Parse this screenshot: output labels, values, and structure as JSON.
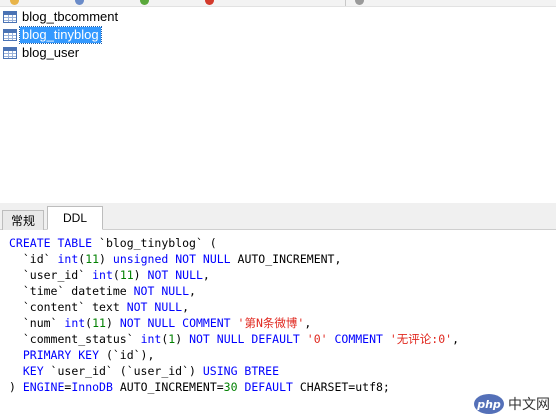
{
  "objects": [
    {
      "name": "blog_tbcomment",
      "selected": false
    },
    {
      "name": "blog_tinyblog",
      "selected": true
    },
    {
      "name": "blog_user",
      "selected": false
    }
  ],
  "tabs": [
    {
      "label": "常规",
      "active": false
    },
    {
      "label": "DDL",
      "active": true
    }
  ],
  "ddl": {
    "lines": [
      [
        [
          "kw",
          "CREATE TABLE "
        ],
        [
          "tx",
          "`blog_tinyblog` ("
        ]
      ],
      [
        [
          "tx",
          "  `id` "
        ],
        [
          "kw",
          "int"
        ],
        [
          "tx",
          "("
        ],
        [
          "num",
          "11"
        ],
        [
          "tx",
          ") "
        ],
        [
          "kw",
          "unsigned NOT NULL "
        ],
        [
          "tx",
          "AUTO_INCREMENT,"
        ]
      ],
      [
        [
          "tx",
          "  `user_id` "
        ],
        [
          "kw",
          "int"
        ],
        [
          "tx",
          "("
        ],
        [
          "num",
          "11"
        ],
        [
          "tx",
          ") "
        ],
        [
          "kw",
          "NOT NULL"
        ],
        [
          "tx",
          ","
        ]
      ],
      [
        [
          "tx",
          "  `time` datetime "
        ],
        [
          "kw",
          "NOT NULL"
        ],
        [
          "tx",
          ","
        ]
      ],
      [
        [
          "tx",
          "  `content` text "
        ],
        [
          "kw",
          "NOT NULL"
        ],
        [
          "tx",
          ","
        ]
      ],
      [
        [
          "tx",
          "  `num` "
        ],
        [
          "kw",
          "int"
        ],
        [
          "tx",
          "("
        ],
        [
          "num",
          "11"
        ],
        [
          "tx",
          ") "
        ],
        [
          "kw",
          "NOT NULL COMMENT "
        ],
        [
          "str",
          "'第N条微博'"
        ],
        [
          "tx",
          ","
        ]
      ],
      [
        [
          "tx",
          "  `comment_status` "
        ],
        [
          "kw",
          "int"
        ],
        [
          "tx",
          "("
        ],
        [
          "num",
          "1"
        ],
        [
          "tx",
          ") "
        ],
        [
          "kw",
          "NOT NULL DEFAULT "
        ],
        [
          "str",
          "'0'"
        ],
        [
          "kw",
          " COMMENT "
        ],
        [
          "str",
          "'无评论:0'"
        ],
        [
          "tx",
          ","
        ]
      ],
      [
        [
          "kw",
          "  PRIMARY KEY "
        ],
        [
          "tx",
          "(`id`),"
        ]
      ],
      [
        [
          "kw",
          "  KEY "
        ],
        [
          "tx",
          "`user_id` (`user_id`) "
        ],
        [
          "kw",
          "USING BTREE"
        ]
      ],
      [
        [
          "tx",
          ") "
        ],
        [
          "kw",
          "ENGINE"
        ],
        [
          "tx",
          "="
        ],
        [
          "kw",
          "InnoDB "
        ],
        [
          "tx",
          "AUTO_INCREMENT="
        ],
        [
          "num",
          "30"
        ],
        [
          "kw",
          " DEFAULT "
        ],
        [
          "tx",
          "CHARSET=utf8;"
        ]
      ]
    ]
  },
  "watermark": {
    "logo": "php",
    "text": "中文网"
  },
  "colors": {
    "keyword": "#0000ff",
    "number": "#008000",
    "string": "#e0281f",
    "selection": "#3399ff"
  },
  "icons": {
    "object_icon": "table-icon"
  }
}
